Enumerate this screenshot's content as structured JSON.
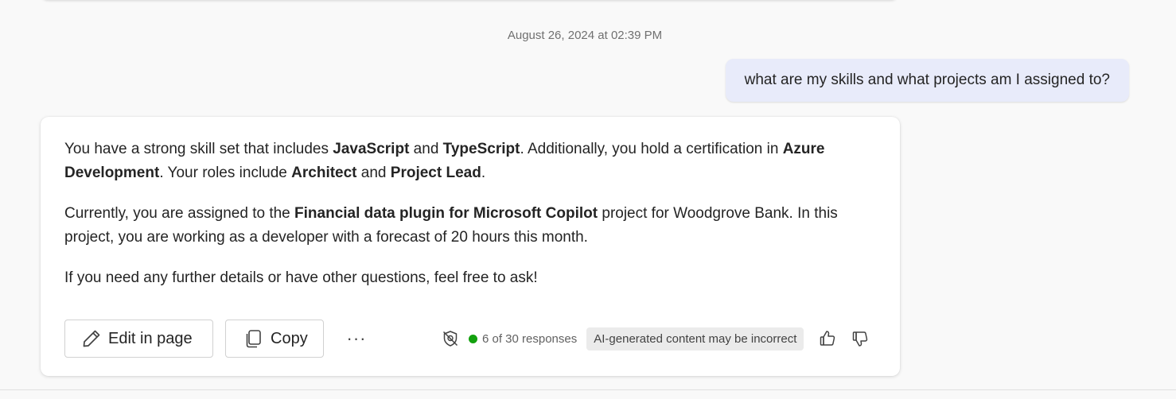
{
  "timestamp": "August 26, 2024 at 02:39 PM",
  "user_message": "what are my skills and what projects am I assigned to?",
  "response": {
    "p1": {
      "t1": "You have a strong skill set that includes ",
      "b1": "JavaScript",
      "t2": " and ",
      "b2": "TypeScript",
      "t3": ". Additionally, you hold a certification in ",
      "b3": "Azure Development",
      "t4": ". Your roles include ",
      "b4": "Architect",
      "t5": " and ",
      "b5": "Project Lead",
      "t6": "."
    },
    "p2": {
      "t1": "Currently, you are assigned to the ",
      "b1": "Financial data plugin for Microsoft Copilot",
      "t2": " project for Woodgrove Bank. In this project, you are working as a developer with a forecast of 20 hours this month."
    },
    "p3": "If you need any further details or have other questions, feel free to ask!"
  },
  "actions": {
    "edit_label": "Edit in page",
    "copy_label": "Copy",
    "more_label": "···",
    "responses_label": "6 of 30 responses",
    "disclaimer": "AI-generated content may be incorrect"
  },
  "icons": {
    "edit": "pencil-icon",
    "copy": "copy-icon",
    "more": "more-horizontal-icon",
    "sensitivity": "shield-off-icon",
    "status": "green-dot-icon",
    "like": "thumbs-up-icon",
    "dislike": "thumbs-down-icon"
  },
  "colors": {
    "user_bubble": "#e8ebfa",
    "status_dot": "#13a10e",
    "badge_bg": "#ebebeb"
  }
}
